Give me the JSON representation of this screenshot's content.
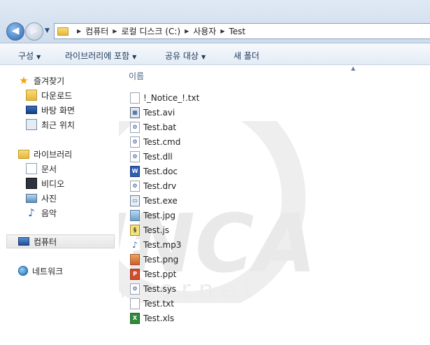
{
  "address_bar": {
    "path": [
      "컴퓨터",
      "로컬 디스크 (C:)",
      "사용자",
      "Test"
    ]
  },
  "toolbar": {
    "organize": "구성",
    "include_in_library": "라이브러리에 포함",
    "share_with": "공유 대상",
    "new_folder": "새 폴더"
  },
  "nav": {
    "favorites": "즐겨찾기",
    "downloads": "다운로드",
    "desktop": "바탕 화면",
    "recent": "최근 위치",
    "libraries": "라이브러리",
    "documents": "문서",
    "videos": "비디오",
    "pictures": "사진",
    "music": "음악",
    "computer": "컴퓨터",
    "network": "네트워크"
  },
  "main": {
    "column_name": "이름",
    "watermark_text": "INCA",
    "watermark_sub": "I n t e r n e t",
    "files": [
      {
        "name": "!_Notice_!.txt",
        "icon": "txt"
      },
      {
        "name": "Test.avi",
        "icon": "avi"
      },
      {
        "name": "Test.bat",
        "icon": "bat"
      },
      {
        "name": "Test.cmd",
        "icon": "cmd"
      },
      {
        "name": "Test.dll",
        "icon": "dll"
      },
      {
        "name": "Test.doc",
        "icon": "doc"
      },
      {
        "name": "Test.drv",
        "icon": "drv"
      },
      {
        "name": "Test.exe",
        "icon": "exe"
      },
      {
        "name": "Test.jpg",
        "icon": "jpg"
      },
      {
        "name": "Test.js",
        "icon": "js"
      },
      {
        "name": "Test.mp3",
        "icon": "mp3"
      },
      {
        "name": "Test.png",
        "icon": "png"
      },
      {
        "name": "Test.ppt",
        "icon": "ppt"
      },
      {
        "name": "Test.sys",
        "icon": "sys"
      },
      {
        "name": "Test.txt",
        "icon": "txt"
      },
      {
        "name": "Test.xls",
        "icon": "xls"
      }
    ]
  }
}
